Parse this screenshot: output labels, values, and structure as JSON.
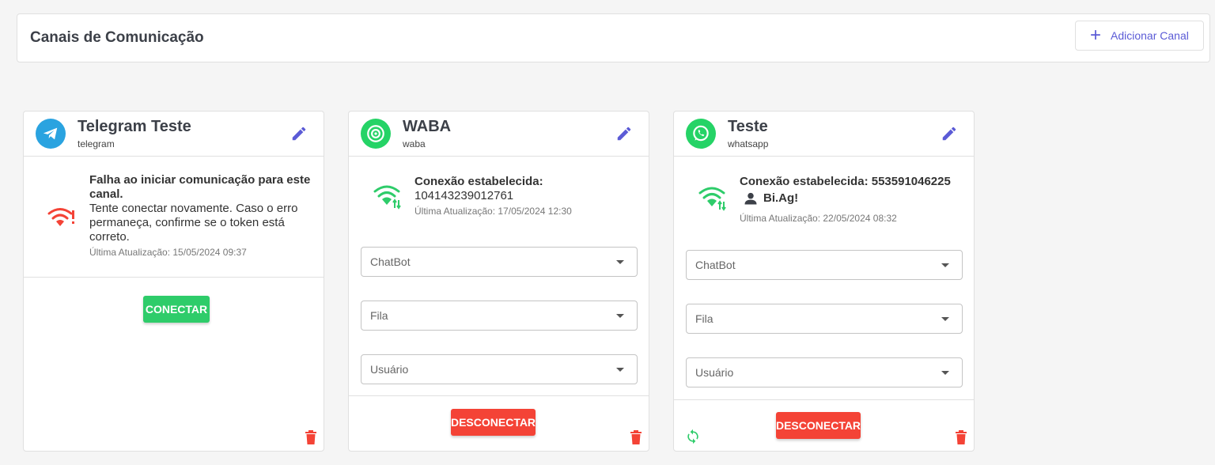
{
  "header": {
    "title": "Canais de Comunicação",
    "add_button": "Adicionar Canal",
    "add_icon": "plus-icon"
  },
  "colors": {
    "accent": "#5b5bd6",
    "green": "#2ecc6a",
    "red": "#f44336",
    "telegram": "#2aa3e0",
    "whatsapp": "#25d366"
  },
  "cards": [
    {
      "name": "Telegram Teste",
      "type": "telegram",
      "status_title": "Falha ao iniciar comunicação para este canal.",
      "status_body": "Tente conectar novamente. Caso o erro permaneça, confirme se o token está correto.",
      "updated": "Última Atualização: 15/05/2024 09:37",
      "action": "CONECTAR"
    },
    {
      "name": "WABA",
      "type": "waba",
      "status_title": "Conexão estabelecida:",
      "status_body": "104143239012761",
      "updated": "Última Atualização: 17/05/2024 12:30",
      "selects": [
        "ChatBot",
        "Fila",
        "Usuário"
      ],
      "action": "DESCONECTAR"
    },
    {
      "name": "Teste",
      "type": "whatsapp",
      "status_title": "Conexão estabelecida: 553591046225",
      "user": "Bi.Ag!",
      "updated": "Última Atualização: 22/05/2024 08:32",
      "selects": [
        "ChatBot",
        "Fila",
        "Usuário"
      ],
      "action": "DESCONECTAR"
    }
  ]
}
